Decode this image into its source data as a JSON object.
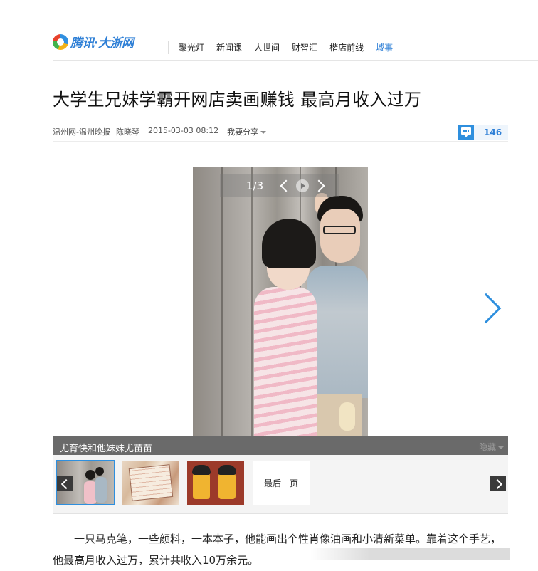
{
  "header": {
    "logo_text": "腾讯·大浙网",
    "nav": [
      {
        "label": "聚光灯",
        "active": false
      },
      {
        "label": "新闻课",
        "active": false
      },
      {
        "label": "人世间",
        "active": false
      },
      {
        "label": "财智汇",
        "active": false
      },
      {
        "label": "楷店前线",
        "active": false
      },
      {
        "label": "城事",
        "active": true
      }
    ]
  },
  "article": {
    "title": "大学生兄妹学霸开网店卖画赚钱 最高月收入过万",
    "source": "温州网-温州晚报",
    "author": "陈晓琴",
    "datetime": "2015-03-03  08:12",
    "share_label": "我要分享",
    "comment_count": "146",
    "body": "一只马克笔，一些颜料，一本本子，他能画出个性肖像油画和小清新菜单。靠着这个手艺，他最高月收入过万，累计共收入10万余元。"
  },
  "gallery": {
    "counter": "1/3",
    "caption": "尤育快和他妹妹尤苗苗",
    "hide_label": "隐藏",
    "last_page_label": "最后一页"
  },
  "colors": {
    "accent": "#2e8fde",
    "link": "#2e7fd6"
  }
}
